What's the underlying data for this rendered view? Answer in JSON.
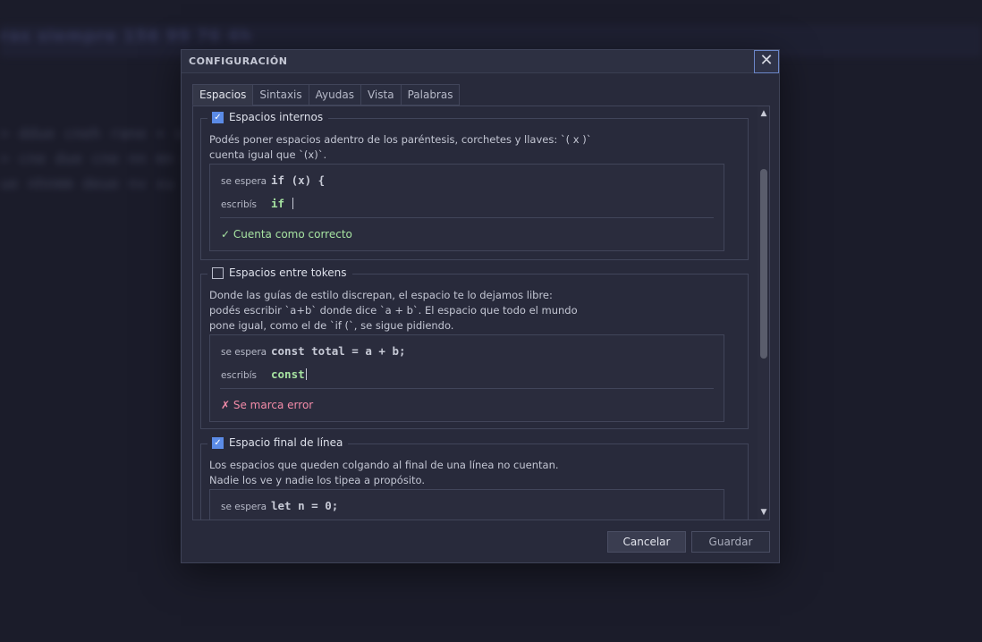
{
  "background": {
    "title": "ras siempre 156 99 76 4h",
    "lines": [
      "> ddue cneh rane = sn nhnm wdhg xu",
      "> cne due cne nn mn ennn md",
      "ue nhnmm deue nv xu"
    ]
  },
  "dialog": {
    "title": "CONFIGURACIÓN",
    "close_glyph": "✕",
    "tabs": [
      "Espacios",
      "Sintaxis",
      "Ayudas",
      "Vista",
      "Palabras"
    ],
    "active_tab": "Espacios",
    "scroll": {
      "up": "▲",
      "down": "▼",
      "position": 0.15
    },
    "groups": [
      {
        "label": "Espacios internos",
        "checked": true,
        "desc": [
          "Podés poner espacios adentro de los paréntesis, corchetes y llaves: `( x )`",
          "cuenta igual que `(x)`."
        ],
        "expected_label": "se espera",
        "expected": "if (x) {",
        "typed_label": "escribís",
        "typed": "if ",
        "verdict": "✓ Cuenta como correcto",
        "verdict_ok": true
      },
      {
        "label": "Espacios entre tokens",
        "checked": false,
        "desc": [
          "Donde las guías de estilo discrepan, el espacio te lo dejamos libre:",
          "podés escribir `a+b` donde dice `a + b`. El espacio que todo el mundo",
          "pone igual, como el de `if (`, se sigue pidiendo."
        ],
        "expected_label": "se espera",
        "expected": "const total = a + b;",
        "typed_label": "escribís",
        "typed": "const",
        "verdict": "✗ Se marca error",
        "verdict_ok": false
      },
      {
        "label": "Espacio final de línea",
        "checked": true,
        "desc": [
          "Los espacios que queden colgando al final de una línea no cuentan.",
          "Nadie los ve y nadie los tipea a propósito."
        ],
        "expected_label": "se espera",
        "expected": "let n = 0;"
      }
    ],
    "buttons": {
      "cancel": "Cancelar",
      "save": "Guardar"
    },
    "checkmark": "✓"
  }
}
